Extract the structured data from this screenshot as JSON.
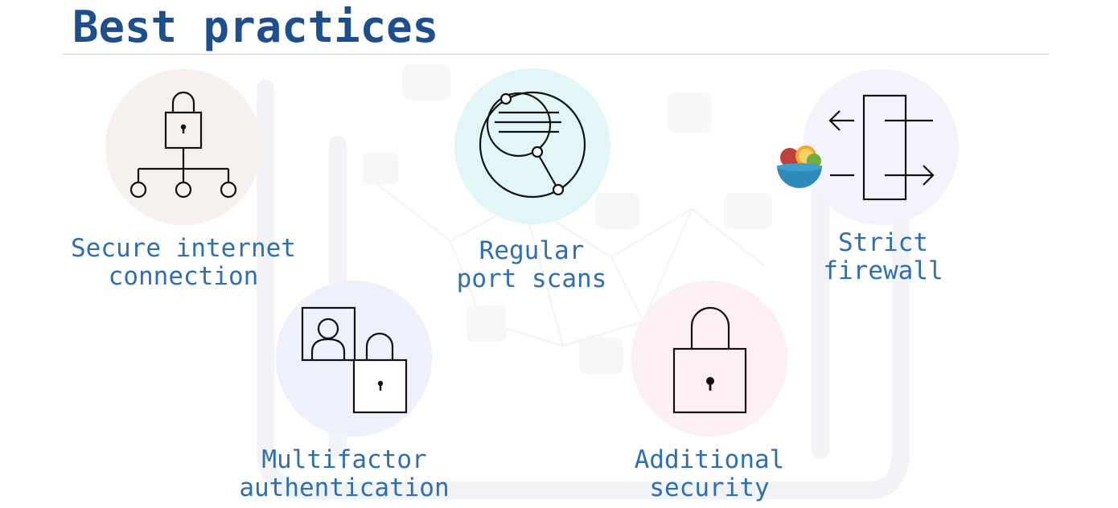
{
  "slide": {
    "title": "Best practices",
    "practices": [
      {
        "label": "Secure internet\nconnection",
        "icon": "network-lock-icon",
        "circle_color": "#f6f0ee"
      },
      {
        "label": "Regular\nport scans",
        "icon": "port-scan-icon",
        "circle_color": "#e2f6f8"
      },
      {
        "label": "Strict\nfirewall",
        "icon": "firewall-icon",
        "circle_color": "#f4f2fb"
      },
      {
        "label": "Multifactor\nauthentication",
        "icon": "multifactor-auth-icon",
        "circle_color": "#eef0fc"
      },
      {
        "label": "Additional\nsecurity",
        "icon": "padlock-icon",
        "circle_color": "#fcf0f3"
      }
    ],
    "colors": {
      "title": "#1f4e8c",
      "label": "#2f6fae",
      "icon_stroke": "#111111"
    }
  }
}
